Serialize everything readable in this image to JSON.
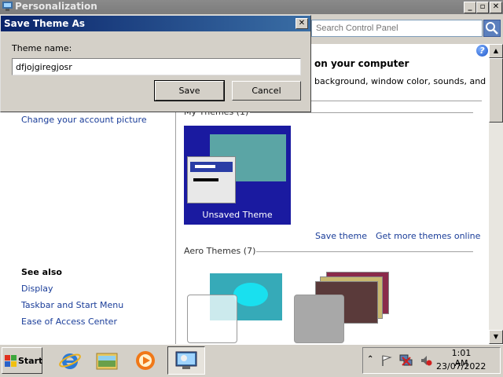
{
  "window": {
    "title": "Personalization",
    "controls": {
      "minimize": "_",
      "restore": "▫",
      "close": "✕"
    }
  },
  "search": {
    "placeholder": "Search Control Panel"
  },
  "main": {
    "heading_partial": "on your computer",
    "subtext_partial": "background, window color, sounds, and",
    "help_icon": "?"
  },
  "left_pane": {
    "links": [
      "Change your account picture"
    ],
    "see_also_title": "See also",
    "see_also_links": [
      "Display",
      "Taskbar and Start Menu",
      "Ease of Access Center"
    ]
  },
  "themes": {
    "my_themes_label": "My Themes (1)",
    "unsaved_theme_label": "Unsaved Theme",
    "save_theme_link": "Save theme",
    "get_more_link": "Get more themes online",
    "aero_label": "Aero Themes (7)"
  },
  "dialog": {
    "title": "Save Theme As",
    "close": "✕",
    "field_label": "Theme name:",
    "field_value": "dfjojgiregjosr",
    "save_label": "Save",
    "cancel_label": "Cancel"
  },
  "taskbar": {
    "start_label": "Start",
    "clock_time": "1:01 AM",
    "clock_date": "23/07/2022",
    "tray_icons": [
      "chevron-up-icon",
      "flag-icon",
      "network-icon",
      "volume-icon"
    ],
    "pinned": [
      "internet-explorer-icon",
      "file-explorer-icon",
      "media-player-icon",
      "control-panel-icon"
    ]
  },
  "colors": {
    "dialog_title": "#0a246a",
    "link": "#1a3d99",
    "theme_bg": "#1a1aa0"
  }
}
